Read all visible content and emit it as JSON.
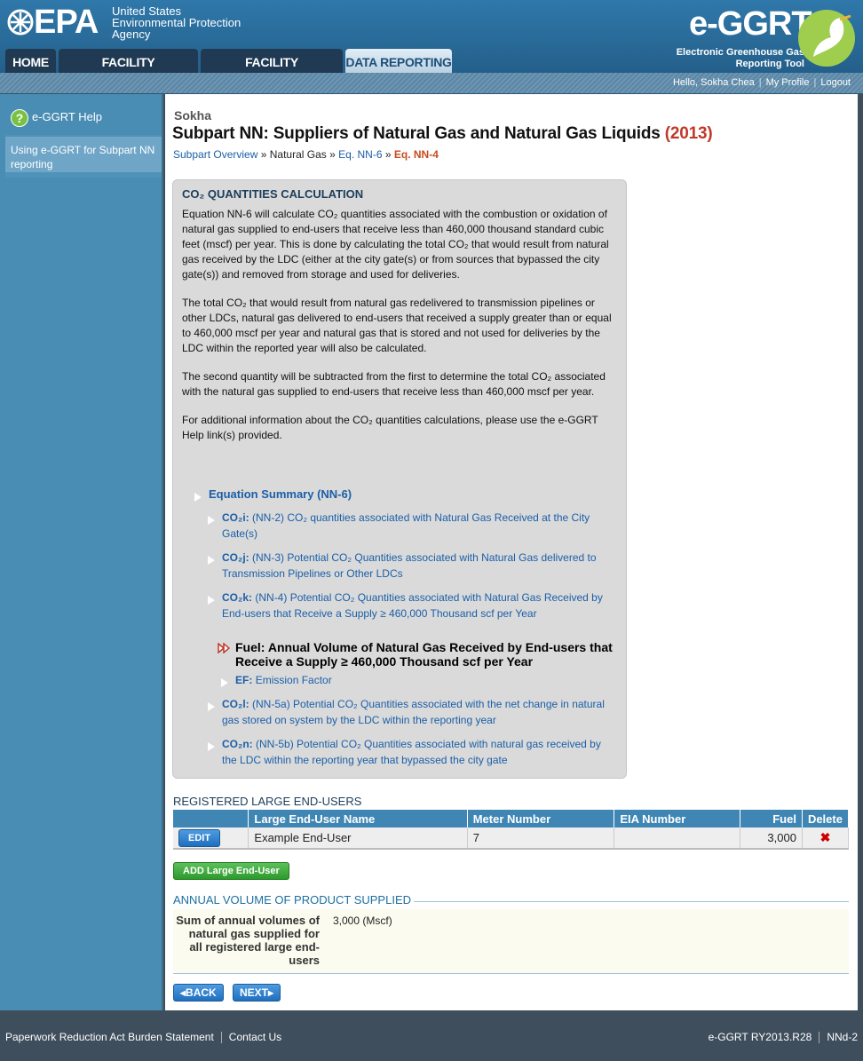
{
  "header": {
    "logo_text": "EPA",
    "agency_lines": [
      "United States",
      "Environmental Protection",
      "Agency"
    ],
    "brand_title": "e-GGRT",
    "brand_sub": [
      "Electronic Greenhouse Gas",
      "Reporting Tool"
    ]
  },
  "nav": {
    "tabs": [
      {
        "label": "HOME"
      },
      {
        "label": "FACILITY REGISTRATION"
      },
      {
        "label": "FACILITY MANAGEMENT"
      },
      {
        "label": "DATA REPORTING"
      }
    ]
  },
  "userbar": {
    "greeting": "Hello, Sokha Chea",
    "profile": "My Profile",
    "logout": "Logout"
  },
  "sidebar": {
    "help_title": "e-GGRT Help",
    "help_link": "Using e-GGRT for Subpart NN reporting"
  },
  "page": {
    "org": "Sokha",
    "title": "Subpart NN: Suppliers of Natural Gas and Natural Gas Liquids",
    "year": "(2013)",
    "breadcrumb": {
      "c1": "Subpart Overview",
      "sep1": "»",
      "c2": "Natural Gas",
      "sep2": "»",
      "c3": "Eq. NN-6",
      "sep3": "»",
      "c4": "Eq. NN-4"
    }
  },
  "info": {
    "heading": "CO₂ QUANTITIES CALCULATION",
    "p1": "Equation NN-6 will calculate CO₂ quantities associated with the combustion or oxidation of natural gas supplied to end-users that receive less than 460,000 thousand standard cubic feet (mscf) per year. This is done by calculating the total CO₂ that would result from natural gas received by the LDC (either at the city gate(s) or from sources that bypassed the city gate(s)) and removed from storage and used for deliveries.",
    "p2": "The total CO₂ that would result from natural gas redelivered to transmission pipelines or other LDCs, natural gas delivered to end-users that received a supply greater than or equal to 460,000 mscf per year and natural gas that is stored and not used for deliveries by the LDC within the reported year will also be calculated.",
    "p3": "The second quantity will be subtracted from the first to determine the total CO₂ associated with the natural gas supplied to end-users that receive less than 460,000 mscf per year.",
    "p4": "For additional information about the CO₂ quantities calculations, please use the e-GGRT Help link(s) provided.",
    "tree": {
      "summary": "Equation Summary (NN-6)",
      "i1_code": "CO₂i:",
      "i1_text": "(NN-2) CO₂ quantities associated with Natural Gas Received at the City Gate(s)",
      "i2_code": "CO₂j:",
      "i2_text": "(NN-3) Potential CO₂ Quantities associated with Natural Gas delivered to Transmission Pipelines or Other LDCs",
      "i3_code": "CO₂k:",
      "i3_text": "(NN-4) Potential CO₂ Quantities associated with Natural Gas Received by End-users that Receive a Supply ≥ 460,000 Thousand scf per Year",
      "fuel_code": "Fuel:",
      "fuel_text": "Annual Volume of Natural Gas Received by End-users that Receive a Supply ≥ 460,000 Thousand scf per Year",
      "ef_code": "EF:",
      "ef_text": "Emission Factor",
      "i4_code": "CO₂l:",
      "i4_text": "(NN-5a) Potential CO₂ Quantities associated with the net change in natural gas stored on system by the LDC within the reporting year",
      "i5_code": "CO₂n:",
      "i5_text": "(NN-5b) Potential CO₂ Quantities associated with natural gas received by the LDC within the reporting year that bypassed the city gate"
    }
  },
  "registered": {
    "title": "REGISTERED LARGE END-USERS",
    "columns": [
      "",
      "Large End-User Name",
      "Meter Number",
      "EIA Number",
      "Fuel",
      "Delete"
    ],
    "rows": [
      {
        "edit": "EDIT",
        "name": "Example End-User",
        "meter": "7",
        "eia": "",
        "fuel": "3,000",
        "delete": "✖"
      }
    ],
    "add_label": "ADD Large End-User"
  },
  "annual": {
    "title": "ANNUAL VOLUME OF PRODUCT SUPPLIED",
    "label": "Sum of annual volumes of natural gas supplied for all registered large end-users",
    "value": "3,000 (Mscf)"
  },
  "buttons": {
    "back": "◂BACK",
    "next": "NEXT▸"
  },
  "footer": {
    "paperwork": "Paperwork Reduction Act Burden Statement",
    "contact": "Contact Us",
    "version": "e-GGRT RY2013.R28",
    "page_id": "NNd-2"
  }
}
